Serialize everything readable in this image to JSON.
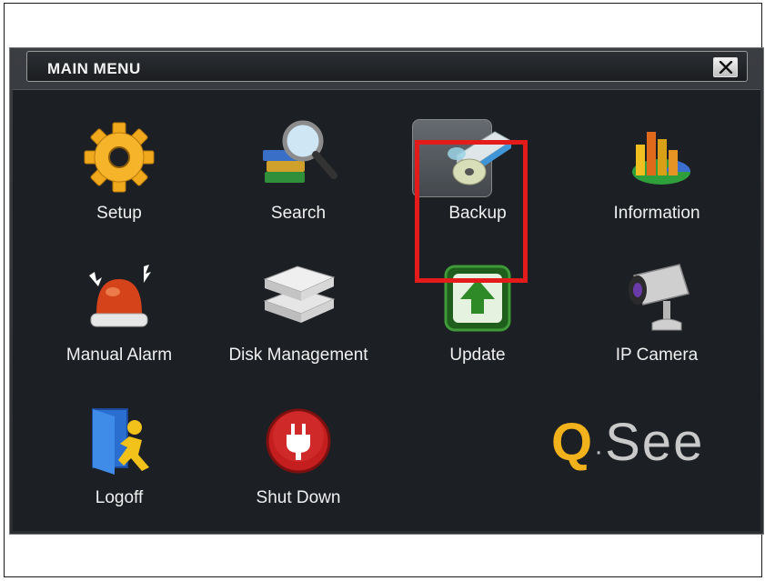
{
  "window": {
    "title": "MAIN MENU",
    "close_label": "✕"
  },
  "menu": {
    "items": [
      {
        "label": "Setup",
        "icon": "gear-icon"
      },
      {
        "label": "Search",
        "icon": "search-books-icon"
      },
      {
        "label": "Backup",
        "icon": "backup-drive-icon",
        "highlighted": true
      },
      {
        "label": "Information",
        "icon": "chart-info-icon"
      },
      {
        "label": "Manual Alarm",
        "icon": "alarm-siren-icon"
      },
      {
        "label": "Disk Management",
        "icon": "hard-disk-icon"
      },
      {
        "label": "Update",
        "icon": "upload-arrow-icon"
      },
      {
        "label": "IP Camera",
        "icon": "security-camera-icon"
      },
      {
        "label": "Logoff",
        "icon": "exit-door-icon"
      },
      {
        "label": "Shut Down",
        "icon": "power-plug-icon"
      }
    ]
  },
  "brand": {
    "q": "Q",
    "rest": "See",
    "accent_color": "#f2b21b"
  },
  "colors": {
    "highlight": "#e41b1b",
    "background": "#1c1f24"
  }
}
